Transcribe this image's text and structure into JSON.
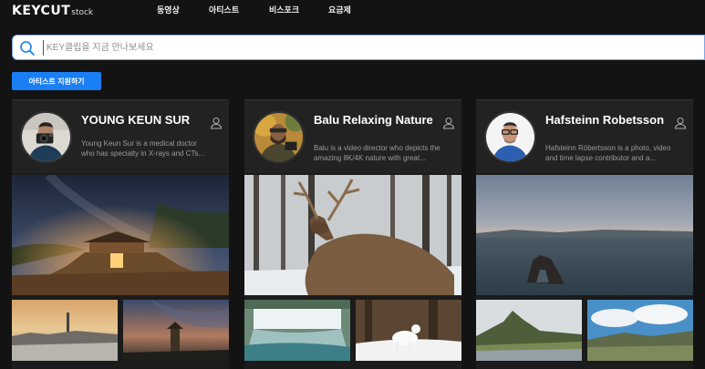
{
  "header": {
    "logo_main": "KEYCUT",
    "logo_sub": "stock",
    "nav": [
      "동영상",
      "아티스트",
      "비스포크",
      "요금제"
    ]
  },
  "search": {
    "placeholder": "KEY클립을 지금 만나보세요",
    "value": ""
  },
  "apply_button": "아티스트 지원하기",
  "artists": [
    {
      "name": "YOUNG KEUN SUR",
      "description": "Young Keun Sur is a medical doctor who has specialty in X-rays and CTs..."
    },
    {
      "name": "Balu Relaxing Nature",
      "description": "Balu is a video director who depicts the amazing 8K/4K nature with great..."
    },
    {
      "name": "Hafsteinn Robetsson",
      "description": "Hafsteinn Röbertsson is a photo, video and time lapse contributor and a..."
    }
  ],
  "icons": {
    "search": "search-icon",
    "user": "user-icon"
  },
  "colors": {
    "accent": "#1a7ef5",
    "background": "#131313",
    "card": "#1b1b1b"
  }
}
